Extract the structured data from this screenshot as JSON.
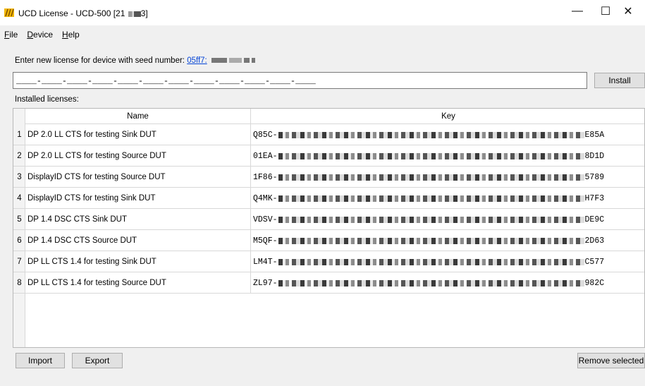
{
  "window": {
    "title": "UCD License - UCD-500 [21",
    "title_suffix": "3]",
    "minimize_glyph": "—",
    "maximize_glyph": "☐",
    "close_glyph": "✕",
    "icon": "app-logo-icon"
  },
  "menu": [
    {
      "hotkey": "F",
      "rest": "ile"
    },
    {
      "hotkey": "D",
      "rest": "evice"
    },
    {
      "hotkey": "H",
      "rest": "elp"
    }
  ],
  "seed": {
    "label": "Enter new license for device with seed number:",
    "link_text": "05ff7:"
  },
  "license_input": {
    "value": "____-____-____-____-____-____-____-____-____-____-____-____"
  },
  "buttons": {
    "install": "Install",
    "import": "Import",
    "export": "Export",
    "remove_selected": "Remove selected"
  },
  "installed_label": "Installed licenses:",
  "table": {
    "headers": [
      "Name",
      "Key"
    ],
    "rows": [
      {
        "num": "1",
        "name": "DP 2.0 LL CTS for testing Sink DUT",
        "key_prefix": "Q85C-",
        "key_suffix": "E85A"
      },
      {
        "num": "2",
        "name": "DP 2.0 LL CTS for testing Source DUT",
        "key_prefix": "01EA-",
        "key_suffix": "8D1D"
      },
      {
        "num": "3",
        "name": "DisplayID CTS for testing Source DUT",
        "key_prefix": "1F86-",
        "key_suffix": "5789"
      },
      {
        "num": "4",
        "name": "DisplayID CTS for testing Sink DUT",
        "key_prefix": "Q4MK-",
        "key_suffix": "H7F3"
      },
      {
        "num": "5",
        "name": "DP 1.4 DSC CTS Sink DUT",
        "key_prefix": "VDSV-",
        "key_suffix": "DE9C"
      },
      {
        "num": "6",
        "name": "DP 1.4 DSC CTS Source DUT",
        "key_prefix": "M5QF-",
        "key_suffix": "2D63"
      },
      {
        "num": "7",
        "name": "DP LL CTS 1.4 for testing Sink DUT",
        "key_prefix": "LM4T-",
        "key_suffix": "C577"
      },
      {
        "num": "8",
        "name": "DP LL CTS 1.4 for testing Source DUT",
        "key_prefix": "ZL97-",
        "key_suffix": "982C"
      }
    ]
  }
}
